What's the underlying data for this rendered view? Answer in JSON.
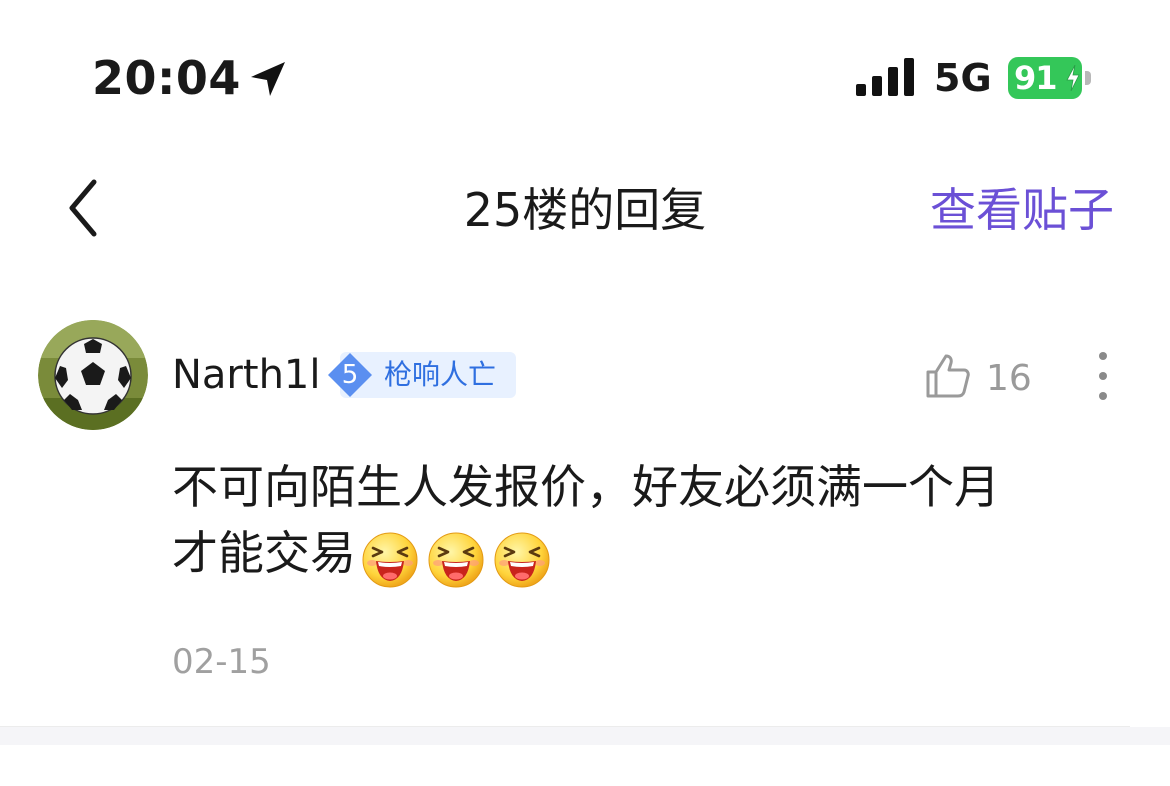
{
  "status_bar": {
    "time": "20:04",
    "location_icon": "location-arrow-icon",
    "signal_icon": "signal-bars-icon",
    "network": "5G",
    "battery_level": "91",
    "battery_color": "#34c759"
  },
  "nav": {
    "back_icon": "chevron-left-icon",
    "title": "25楼的回复",
    "view_post_label": "查看贴子",
    "accent_color": "#6b50d6"
  },
  "comment": {
    "username": "Narth1l",
    "level": "5",
    "level_title": "枪响人亡",
    "like_icon": "thumbs-up-icon",
    "like_count": "16",
    "more_icon": "vertical-dots-icon",
    "text_line1": "不可向陌生人发报价，好友必须满一个月",
    "text_line2": "才能交易",
    "emoji_icon": "laughing-face-emoji",
    "emoji_count": 3,
    "date": "02-15"
  }
}
